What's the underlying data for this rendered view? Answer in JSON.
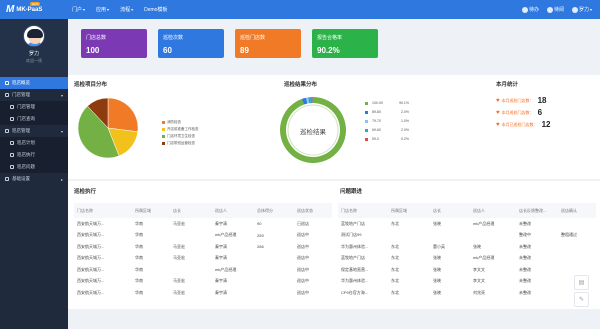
{
  "topbar": {
    "logo_mark": "M",
    "logo_text": "MK-PaaS",
    "logo_badge": "HOT",
    "nav": [
      {
        "label": "门户",
        "caret": "▾"
      },
      {
        "label": "应用",
        "caret": "▾"
      },
      {
        "label": "流程",
        "caret": "▾"
      },
      {
        "label": "Demo模板",
        "caret": ""
      }
    ],
    "right": [
      {
        "icon": "bell-icon",
        "label": "待办"
      },
      {
        "icon": "message-icon",
        "label": "待阅"
      },
      {
        "icon": "user-icon",
        "label": "罗力"
      }
    ]
  },
  "sidebar": {
    "name": "罗力",
    "subtitle": "欢迎一线",
    "items": [
      {
        "label": "巡店概览",
        "type": "top",
        "active": true
      },
      {
        "label": "门店管理",
        "type": "group"
      },
      {
        "label": "门店管理",
        "type": "sub"
      },
      {
        "label": "门店查询",
        "type": "sub"
      },
      {
        "label": "巡店管理",
        "type": "group"
      },
      {
        "label": "巡店计划",
        "type": "sub"
      },
      {
        "label": "巡店执行",
        "type": "sub"
      },
      {
        "label": "巡店问题",
        "type": "sub"
      },
      {
        "label": "基础设置",
        "type": "group"
      }
    ]
  },
  "cards": [
    {
      "label": "门店总数",
      "value": "100",
      "color": "#7b39b3"
    },
    {
      "label": "巡检次数",
      "value": "60",
      "color": "#2f78e0"
    },
    {
      "label": "巡检门店数",
      "value": "89",
      "color": "#f07a26"
    },
    {
      "label": "报告合格率",
      "value": "90.2%",
      "color": "#2bb34a"
    }
  ],
  "pie_panel": {
    "title": "巡检项目分布",
    "legend": [
      "消防检查",
      "开店前准备工作检查",
      "门店环境卫生检查",
      "门店带班运营检查"
    ],
    "colors": [
      "#f07a26",
      "#f1c21b",
      "#74b144",
      "#8e3b10"
    ]
  },
  "donut_panel": {
    "title": "巡检结果分布",
    "center_label": "巡检结果",
    "legend": [
      {
        "label": "100-90",
        "pct": "90.1%",
        "color": "#74b144"
      },
      {
        "label": "89-80",
        "pct": "2.0%",
        "color": "#2f78e0"
      },
      {
        "label": "79-70",
        "pct": "1.0%",
        "color": "#8fc3f0"
      },
      {
        "label": "69-60",
        "pct": "2.0%",
        "color": "#3aa2c9"
      },
      {
        "label": "59-0",
        "pct": "0.2%",
        "color": "#e04a3a"
      }
    ]
  },
  "monthly": {
    "title": "本月统计",
    "rows": [
      {
        "label": "本月巡检门店数：",
        "value": "18"
      },
      {
        "label": "本月巡检门店数：",
        "value": "6"
      },
      {
        "label": "本月已巡检门店数：",
        "value": "12"
      }
    ]
  },
  "exec_table": {
    "title": "巡检执行",
    "headers": [
      "门店名称",
      "所属区域",
      "店长",
      "巡店人",
      "总体得分",
      "巡店状态"
    ],
    "rows": [
      [
        "西安航天城万...",
        "华南",
        "马亚宏",
        "秦宇清",
        "90",
        "已巡店"
      ],
      [
        "西安航天城万...",
        "华南",
        "",
        "mk产品经理",
        "259",
        "巡店中"
      ],
      [
        "西安航天城万...",
        "华南",
        "马亚宏",
        "秦宇清",
        "266",
        "巡店中"
      ],
      [
        "西安航天城万...",
        "华南",
        "马亚宏",
        "秦宇清",
        "",
        "巡店中"
      ],
      [
        "西安航天城万...",
        "华南",
        "",
        "mk产品经理",
        "",
        "巡店中"
      ],
      [
        "西安航天城万...",
        "华南",
        "马亚宏",
        "秦宇清",
        "",
        "巡店中"
      ],
      [
        "西安航天城万...",
        "华南",
        "马亚宏",
        "秦宇清",
        "",
        "巡店中"
      ]
    ]
  },
  "issue_table": {
    "title": "问题跟进",
    "headers": [
      "门店名称",
      "所属区域",
      "店长",
      "巡店人",
      "店长反馈整改...",
      "巡店确认"
    ],
    "rows": [
      [
        "蓝牧地产门店",
        "东北",
        "张晓",
        "mk产品经理",
        "未整改",
        ""
      ],
      [
        "测试门店99",
        "",
        "",
        "",
        "整改中",
        "整租通过"
      ],
      [
        "华为惠州体验...",
        "东北",
        "董小英",
        "张晓",
        "未整改",
        ""
      ],
      [
        "蓝牧地产门店",
        "东北",
        "张晓",
        "mk产品经理",
        "未整改",
        ""
      ],
      [
        "保定基地直营...",
        "东北",
        "张晓",
        "李文文",
        "未整改",
        ""
      ],
      [
        "华为惠州体验...",
        "东北",
        "张晓",
        "李文文",
        "未整改",
        ""
      ],
      [
        "CP9仓官方海...",
        "东北",
        "张晓",
        "刘兆亮",
        "未整改",
        ""
      ]
    ]
  },
  "pie_data": {
    "type": "pie",
    "labels": [
      "消防检查",
      "开店前准备工作检查",
      "门店环境卫生检查",
      "门店带班运营检查"
    ],
    "values": [
      27,
      17,
      44,
      12
    ]
  },
  "donut_data": {
    "type": "pie",
    "labels": [
      "100-90",
      "89-80",
      "79-70",
      "69-60",
      "59-0"
    ],
    "values": [
      90.1,
      2.0,
      1.0,
      2.0,
      0.2
    ]
  }
}
